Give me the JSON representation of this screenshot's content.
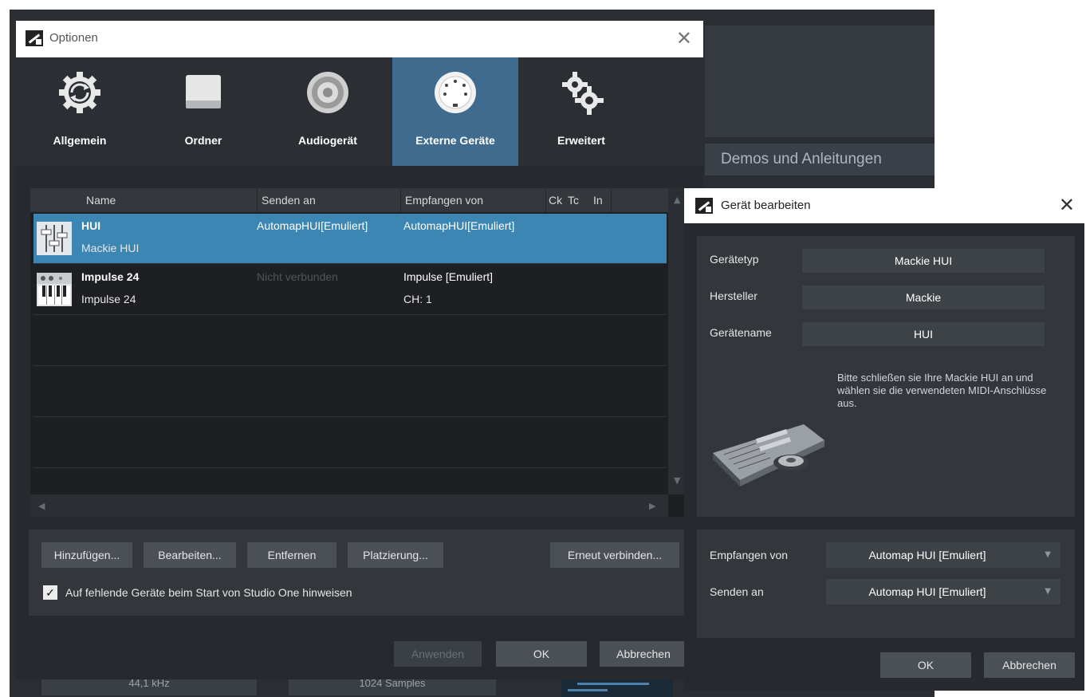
{
  "background": {
    "demos_label": "Demos und Anleitungen",
    "bottom_left": "44,1 kHz",
    "bottom_mid": "1024 Samples"
  },
  "options_window": {
    "title": "Optionen",
    "tabs": [
      {
        "label": "Allgemein",
        "icon": "gear-refresh-icon",
        "active": false
      },
      {
        "label": "Ordner",
        "icon": "drive-icon",
        "active": false
      },
      {
        "label": "Audiogerät",
        "icon": "speaker-icon",
        "active": false
      },
      {
        "label": "Externe Geräte",
        "icon": "midi-port-icon",
        "active": true
      },
      {
        "label": "Erweitert",
        "icon": "gears-icon",
        "active": false
      }
    ],
    "columns": [
      "Name",
      "Senden an",
      "Empfangen von",
      "Ck",
      "Tc",
      "In"
    ],
    "devices": [
      {
        "name": "HUI",
        "model": "Mackie HUI",
        "send": "AutomapHUI[Emuliert]",
        "receive": "AutomapHUI[Emuliert]",
        "receive_ch": "",
        "selected": true,
        "icon": "fader-icon"
      },
      {
        "name": "Impulse 24",
        "model": "Impulse 24",
        "send": "Nicht verbunden",
        "receive": "Impulse [Emuliert]",
        "receive_ch": "CH: 1",
        "selected": false,
        "icon": "keyboard-icon"
      }
    ],
    "buttons": {
      "add": "Hinzufügen...",
      "edit": "Bearbeiten...",
      "remove": "Entfernen",
      "placement": "Platzierung...",
      "reconnect": "Erneut verbinden..."
    },
    "notify_checkbox": {
      "label": "Auf fehlende Geräte beim Start von Studio One hinweisen",
      "checked": true,
      "mark": "✓"
    },
    "footer": {
      "apply": "Anwenden",
      "ok": "OK",
      "cancel": "Abbrechen"
    }
  },
  "edit_dialog": {
    "title": "Gerät bearbeiten",
    "fields": [
      {
        "label": "Gerätetyp",
        "value": "Mackie HUI"
      },
      {
        "label": "Hersteller",
        "value": "Mackie"
      },
      {
        "label": "Gerätename",
        "value": "HUI"
      }
    ],
    "info": "Bitte schließen sie Ihre Mackie HUI an und wählen sie die verwendeten MIDI-Anschlüsse aus.",
    "receive": {
      "label": "Empfangen von",
      "value": "Automap HUI [Emuliert]"
    },
    "send": {
      "label": "Senden an",
      "value": "Automap HUI [Emuliert]"
    },
    "ok": "OK",
    "cancel": "Abbrechen"
  },
  "colors": {
    "accent": "#3f6b8e",
    "selection": "#3c86b4",
    "window_bg": "#26292d"
  }
}
